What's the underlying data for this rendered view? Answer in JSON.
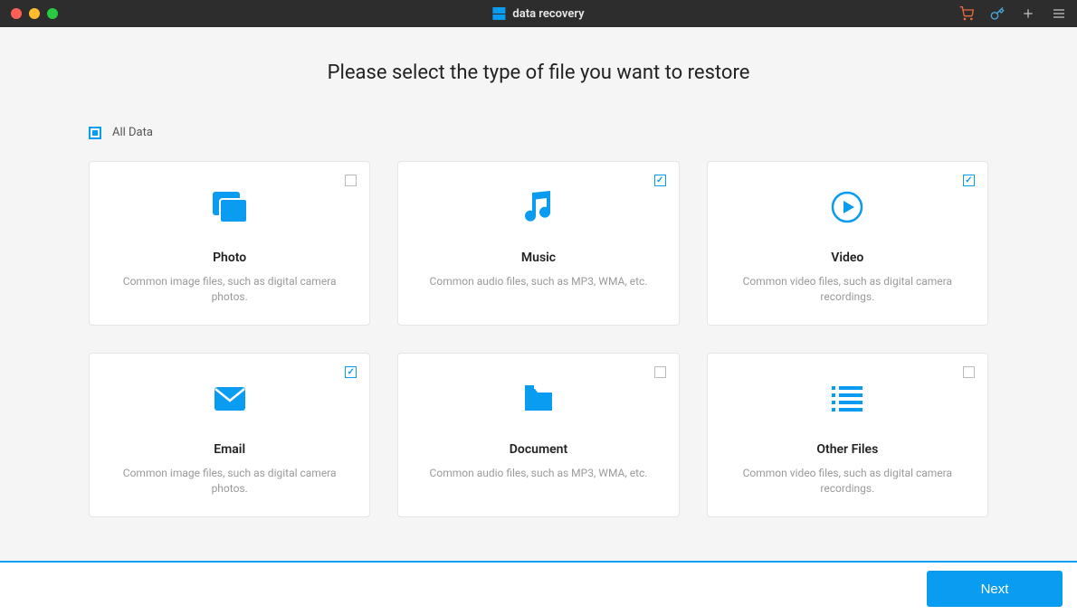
{
  "app": {
    "title": "data recovery"
  },
  "prompt": "Please select the type of file you want to restore",
  "all_data": {
    "label": "All Data",
    "checked": true
  },
  "cards": [
    {
      "key": "photo",
      "title": "Photo",
      "desc": "Common image files, such as digital camera photos.",
      "checked": false
    },
    {
      "key": "music",
      "title": "Music",
      "desc": "Common audio files, such as MP3, WMA, etc.",
      "checked": true
    },
    {
      "key": "video",
      "title": "Video",
      "desc": "Common video files, such as digital camera recordings.",
      "checked": true
    },
    {
      "key": "email",
      "title": "Email",
      "desc": "Common image files, such as digital camera photos.",
      "checked": true
    },
    {
      "key": "document",
      "title": "Document",
      "desc": "Common audio files, such as MP3, WMA, etc.",
      "checked": false
    },
    {
      "key": "other",
      "title": "Other Files",
      "desc": "Common video files, such as digital camera recordings.",
      "checked": false
    }
  ],
  "footer": {
    "next_label": "Next"
  },
  "colors": {
    "accent": "#0a9cf0"
  }
}
